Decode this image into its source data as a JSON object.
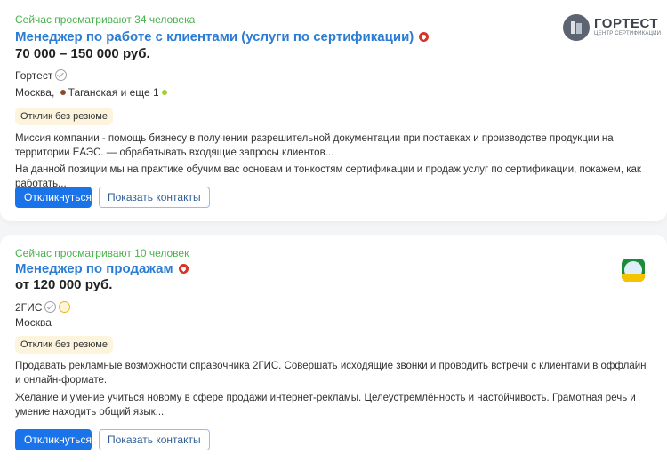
{
  "vacancies": [
    {
      "viewers": "Сейчас просматривают 34 человека",
      "title": "Менеджер по работе с клиентами (услуги по сертификации)",
      "salary": "70 000 – 150 000 руб.",
      "company": "Гортест",
      "city": "Москва,",
      "metro": "Таганская",
      "metro_more": "и еще 1",
      "badge": "Отклик без резюме",
      "description": [
        "Миссия компании - помощь бизнесу в получении разрешительной документации при поставках и производстве продукции на территории ЕАЭС. — обрабатывать входящие запросы клиентов...",
        "На данной позиции мы на практике обучим вас основам и тонкостям сертификации и продаж услуг по сертификации, покажем, как работать..."
      ],
      "respond_label": "Откликнуться",
      "contacts_label": "Показать контакты",
      "logo": {
        "name": "ГОРТЕСТ",
        "subtitle": "ЦЕНТР СЕРТИФИКАЦИИ"
      }
    },
    {
      "viewers": "Сейчас просматривают 10 человек",
      "title": "Менеджер по продажам",
      "salary": "от 120 000 руб.",
      "company": "2ГИС",
      "city": "Москва",
      "badge": "Отклик без резюме",
      "description": [
        "Продавать рекламные возможности справочника 2ГИС. Совершать исходящие звонки и проводить встречи с клиентами в оффлайн и онлайн-формате.",
        "Желание и умение учиться новому в сфере продажи интернет-рекламы. Целеустремлённость и настойчивость. Грамотная речь и умение находить общий язык..."
      ],
      "respond_label": "Откликнуться",
      "contacts_label": "Показать контакты"
    }
  ],
  "colors": {
    "title": "#2b7cd3",
    "viewers": "#4bb24e",
    "metro_taganskaya": "#8b4b2b",
    "metro_extra": "#9bd22e",
    "primary_button": "#1a73e8",
    "badge_bg": "#fdf4dd"
  },
  "icons": [
    "fire-icon",
    "verified-check-icon",
    "coin-icon",
    "metro-dot-icon"
  ]
}
